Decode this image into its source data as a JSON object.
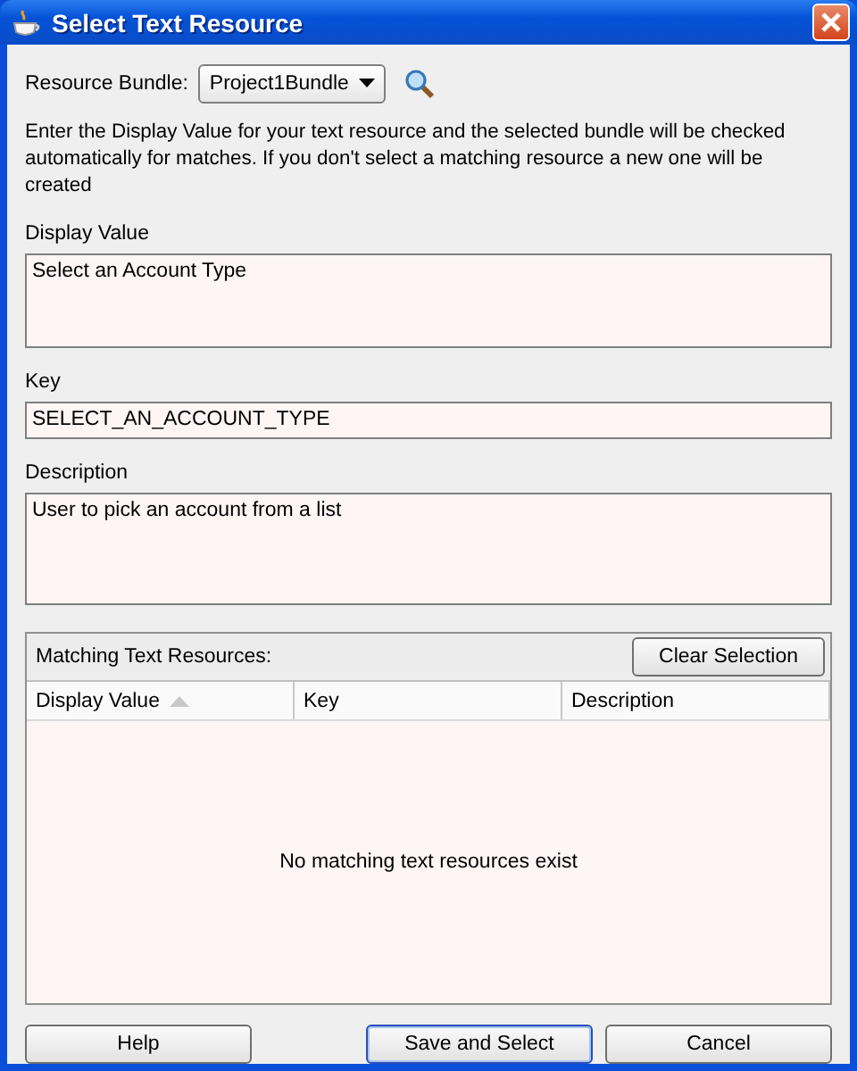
{
  "window": {
    "title": "Select Text Resource"
  },
  "resource_bundle": {
    "label": "Resource Bundle:",
    "value": "Project1Bundle"
  },
  "instructions": "Enter the Display Value for your text resource and the selected bundle will be checked automatically for matches.  If you don't select a matching resource a new one will be created",
  "fields": [
    {
      "kind": "multiline",
      "label": "Display Value",
      "value": "Select an Account Type"
    },
    {
      "kind": "single",
      "label": "Key",
      "value": "SELECT_AN_ACCOUNT_TYPE"
    },
    {
      "kind": "multiline",
      "label": "Description",
      "value": "User to pick an account from a list"
    }
  ],
  "matches": {
    "label": "Matching Text Resources:",
    "clear_button": "Clear Selection",
    "columns": [
      {
        "label": "Display Value",
        "sorted": true
      },
      {
        "label": "Key",
        "sorted": false
      },
      {
        "label": "Description",
        "sorted": false
      }
    ],
    "empty_message": "No matching text resources exist"
  },
  "buttons": [
    {
      "label": "Help",
      "default": false
    },
    {
      "label": "Save and Select",
      "default": true
    },
    {
      "label": "Cancel",
      "default": false
    }
  ]
}
